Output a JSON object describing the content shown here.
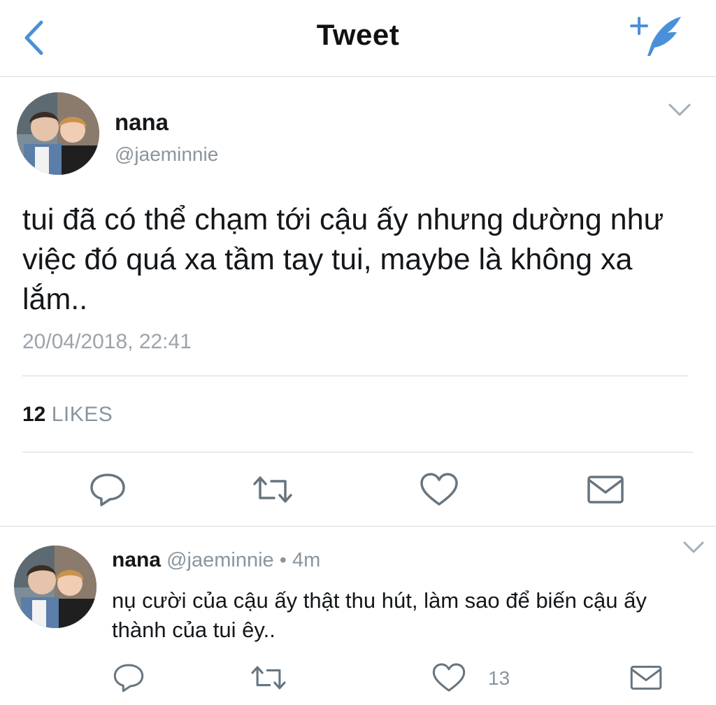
{
  "header": {
    "title": "Tweet",
    "back_icon": "back-chevron-icon",
    "compose_icon": "compose-feather-icon"
  },
  "colors": {
    "accent": "#4a90d9",
    "text": "#14171a",
    "muted": "#8a959e",
    "divider": "#d6d9dc",
    "icon": "#667580"
  },
  "main_tweet": {
    "name": "nana",
    "handle": "@jaeminnie",
    "text": "tui đã có thể chạm tới cậu ấy nhưng dường như việc đó quá xa tầm tay tui, maybe là không xa lắm..",
    "timestamp": "20/04/2018, 22:41",
    "likes_count": "12",
    "likes_label": "LIKES",
    "actions": [
      "reply-icon",
      "retweet-icon",
      "like-icon",
      "direct-message-icon"
    ]
  },
  "reply_tweet": {
    "name": "nana",
    "handle": "@jaeminnie",
    "separator": "•",
    "time": "4m",
    "text": "nụ cười của cậu ấy thật thu hút, làm sao để biến cậu ấy thành của tui êy..",
    "like_count": "13",
    "actions": [
      "reply-icon",
      "retweet-icon",
      "like-icon",
      "direct-message-icon"
    ]
  }
}
